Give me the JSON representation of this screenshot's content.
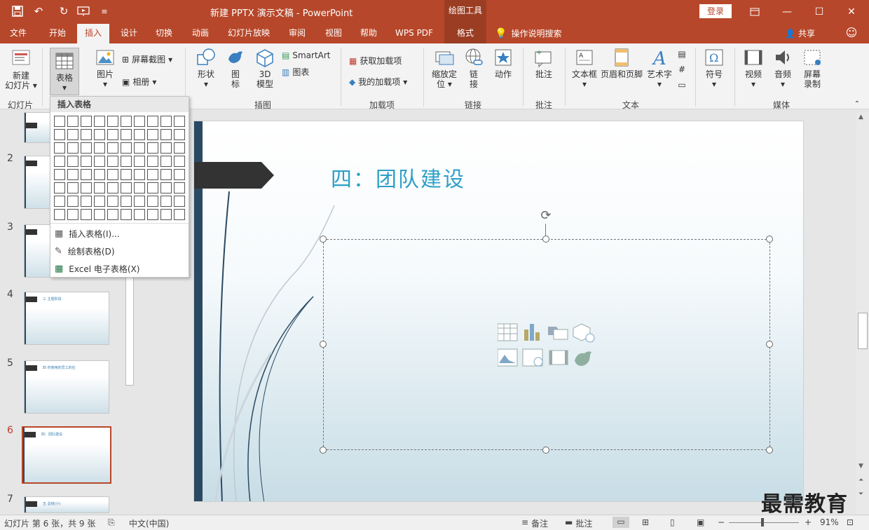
{
  "title": {
    "doc_title": "新建 PPTX 演示文稿  -  PowerPoint",
    "context_tab": "绘图工具",
    "login": "登录"
  },
  "tabs": [
    {
      "label": "文件"
    },
    {
      "label": "开始"
    },
    {
      "label": "插入"
    },
    {
      "label": "设计"
    },
    {
      "label": "切换"
    },
    {
      "label": "动画"
    },
    {
      "label": "幻灯片放映"
    },
    {
      "label": "审阅"
    },
    {
      "label": "视图"
    },
    {
      "label": "帮助"
    },
    {
      "label": "WPS PDF"
    },
    {
      "label": "格式"
    }
  ],
  "tell_me": "操作说明搜索",
  "share": "共享",
  "ribbon": {
    "new_slide": "新建\n幻灯片",
    "new_slide_l1": "新建",
    "new_slide_l2": "幻灯片",
    "table": "表格",
    "pictures": "图片",
    "screenshot": "屏幕截图",
    "album": "相册",
    "shapes": "形状",
    "icons_l1": "图",
    "icons_l2": "标",
    "model3d_l1": "3D",
    "model3d_l2": "模型",
    "smartart": "SmartArt",
    "chart": "图表",
    "get_addins": "获取加载项",
    "my_addins": "我的加载项",
    "zoom_l1": "缩放定",
    "zoom_l2": "位",
    "link_l1": "链",
    "link_l2": "接",
    "action": "动作",
    "comment": "批注",
    "textbox": "文本框",
    "header_footer": "页眉和页脚",
    "wordart": "艺术字",
    "symbol": "符号",
    "video": "视频",
    "audio": "音频",
    "screen_rec_l1": "屏幕",
    "screen_rec_l2": "录制",
    "groups": {
      "slides": "幻灯片",
      "images": "插图",
      "addins": "加载项",
      "links": "链接",
      "comments": "批注",
      "text": "文本",
      "media": "媒体"
    }
  },
  "dropdown": {
    "header": "插入表格",
    "insert_table": "插入表格(I)...",
    "draw_table": "绘制表格(D)",
    "excel_table": "Excel 电子表格(X)"
  },
  "thumbnails": [
    {
      "num": "2",
      "title": ""
    },
    {
      "num": "3",
      "title": ""
    },
    {
      "num": "4",
      "title": "三  主题阶段"
    },
    {
      "num": "5",
      "title": "四  你使用的员工的在"
    },
    {
      "num": "6",
      "title": "四：团队建设"
    },
    {
      "num": "7",
      "title": "五  总结(小)"
    }
  ],
  "slide": {
    "title": "四：团队建设"
  },
  "status": {
    "slide_info": "幻灯片 第 6 张，共 9 张",
    "language": "中文(中国)",
    "notes": "备注",
    "comments": "批注",
    "zoom": "91%"
  },
  "watermark": "最需教育",
  "colors": {
    "brand": "#b7472a",
    "accent_title": "#2ea0c8"
  }
}
